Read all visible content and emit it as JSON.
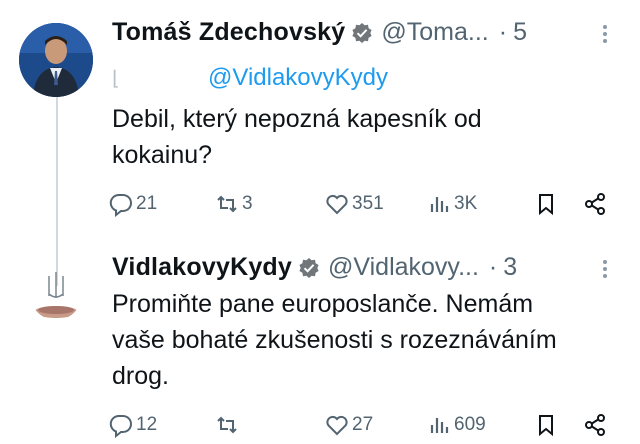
{
  "tweets": [
    {
      "author_name": "Tomáš Zdechovský",
      "author_handle": "@Toma...",
      "time": "5",
      "reply_handle": "@VidlakovyKydy",
      "text": "Debil, který nepozná kapesník od\nkokainu?",
      "replies": "21",
      "reposts": "3",
      "likes": "351",
      "views": "3K"
    },
    {
      "author_name": "VidlakovyKydy",
      "author_handle": "@Vidlakovy...",
      "time": "3",
      "text": "Promiňte pane  europoslanče. Nemám\nvaše bohaté zkušenosti s rozeznáváním\ndrog.",
      "replies": "12",
      "reposts": "",
      "likes": "27",
      "views": "609"
    }
  ],
  "separator": "·",
  "icons": [
    "verified-badge-icon",
    "more-icon",
    "reply-icon",
    "repost-icon",
    "like-icon",
    "views-icon",
    "bookmark-icon",
    "share-icon"
  ],
  "colors": {
    "handle": "#536471",
    "link": "#1d9bf0",
    "verified": "#71767b"
  }
}
